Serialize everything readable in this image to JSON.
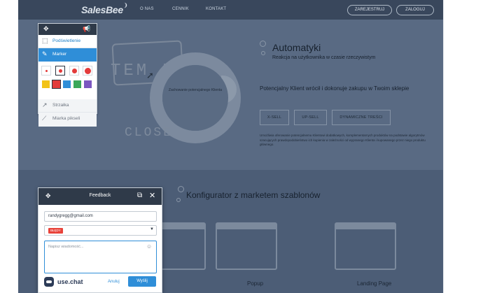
{
  "site": {
    "logo": "SalesBee",
    "nav": [
      "O NAS",
      "CENNIK",
      "KONTAKT"
    ],
    "register_label": "ZAREJESTRUJ",
    "login_label": "ZALOGUJ"
  },
  "hero": {
    "art_text": "TEM IN",
    "art_close": "CLOSE",
    "ring_caption": "Zachowanie potencjalnego Klienta",
    "title": "Automatyki",
    "subtitle": "Reakcja na użytkownika w czasie rzeczywistym",
    "heading": "Potencjalny Klient wrócił i dokonuje zakupu w Twoim sklepie",
    "tags": [
      "X-SELL",
      "UP-SELL",
      "DYNAMICZNE TREŚCI"
    ],
    "body": "Umożliwia oferowanie potencjalnemu Klientowi dodatkowych, komplementarnych produktów na podstawie algorytmów szacujących prawdopodobieństwo ich kupienia w zależności od wypranego Klienta i kupowanego przez niego produktu głównego."
  },
  "section2": {
    "title": "Konfigurator z marketem szablonów",
    "cards": [
      "Popup",
      "Landing Page"
    ]
  },
  "toolbar": {
    "move_icon": "move-icon",
    "announce_icon": "megaphone-icon",
    "tools": {
      "highlight": "Podświetlenie",
      "marker": "Marker",
      "arrow": "Strzałka",
      "ruler": "Miarka pikseli"
    },
    "colors": [
      "#f2c318",
      "#e33b3b",
      "#2f8ed8",
      "#3aa85a",
      "#7b57c0"
    ],
    "selected_color": "#e33b3b",
    "selected_size": 2
  },
  "feedback": {
    "title": "Feedback",
    "email": "randygregg@gmail.com",
    "category": "BŁĘDY",
    "message_placeholder": "Napisz wiadomość...",
    "brand": "use.chat",
    "cancel_label": "Anuluj",
    "send_label": "Wyślij"
  }
}
